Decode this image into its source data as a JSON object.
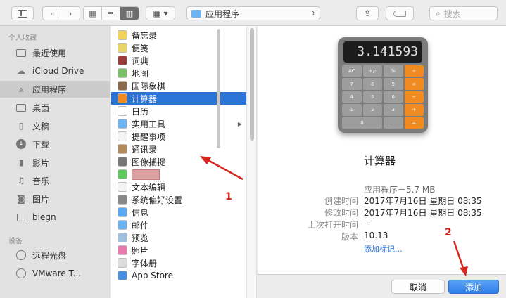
{
  "toolbar": {
    "path_folder": "应用程序",
    "search_placeholder": "搜索"
  },
  "sidebar": {
    "favorites_header": "个人收藏",
    "devices_header": "设备",
    "items": [
      {
        "label": "最近使用",
        "icon": "recent-icon"
      },
      {
        "label": "iCloud Drive",
        "icon": "cloud-icon"
      },
      {
        "label": "应用程序",
        "icon": "apps-icon",
        "selected": true
      },
      {
        "label": "桌面",
        "icon": "desktop-icon"
      },
      {
        "label": "文稿",
        "icon": "documents-icon"
      },
      {
        "label": "下载",
        "icon": "download-icon"
      },
      {
        "label": "影片",
        "icon": "movies-icon"
      },
      {
        "label": "音乐",
        "icon": "music-icon"
      },
      {
        "label": "图片",
        "icon": "pictures-icon"
      },
      {
        "label": "blegn",
        "icon": "home-icon"
      }
    ],
    "devices": [
      {
        "label": "远程光盘",
        "icon": "disc-icon"
      },
      {
        "label": "VMware T...",
        "icon": "disc-icon"
      }
    ]
  },
  "list": [
    {
      "label": "备忘录",
      "color": "#f2d35b"
    },
    {
      "label": "便笺",
      "color": "#e9d46a"
    },
    {
      "label": "词典",
      "color": "#9b3b3b"
    },
    {
      "label": "地图",
      "color": "#7cc06a"
    },
    {
      "label": "国际象棋",
      "color": "#8a6a4a"
    },
    {
      "label": "计算器",
      "color": "#f08a23",
      "selected": true
    },
    {
      "label": "日历",
      "color": "#ffffff"
    },
    {
      "label": "实用工具",
      "color": "#6fb2f0",
      "folder": true
    },
    {
      "label": "提醒事项",
      "color": "#f4f4f4"
    },
    {
      "label": "通讯录",
      "color": "#b08a5a"
    },
    {
      "label": "图像捕捉",
      "color": "#777777"
    },
    {
      "label": "",
      "color": "#5cc85c",
      "redacted": true
    },
    {
      "label": "文本编辑",
      "color": "#f4f4f4"
    },
    {
      "label": "系统偏好设置",
      "color": "#888888"
    },
    {
      "label": "信息",
      "color": "#5aa8f0"
    },
    {
      "label": "邮件",
      "color": "#6fb2f0"
    },
    {
      "label": "预览",
      "color": "#a0c0e0"
    },
    {
      "label": "照片",
      "color": "#e87ab0"
    },
    {
      "label": "字体册",
      "color": "#dddddd"
    },
    {
      "label": "App Store",
      "color": "#4a90e2"
    }
  ],
  "preview": {
    "calc_display": "3.141593",
    "title": "计算器",
    "kind_size": "应用程序－5.7 MB",
    "meta": [
      {
        "label": "创建时间",
        "value": "2017年7月16日 星期日 08:35"
      },
      {
        "label": "修改时间",
        "value": "2017年7月16日 星期日 08:35"
      },
      {
        "label": "上次打开时间",
        "value": "--"
      },
      {
        "label": "版本",
        "value": "10.13"
      }
    ],
    "add_tags": "添加标记..."
  },
  "buttons": {
    "cancel": "取消",
    "add": "添加"
  },
  "annotations": {
    "n1": "1",
    "n2": "2"
  },
  "colors": {
    "selection": "#2a74d6",
    "annotation": "#d7261d"
  }
}
